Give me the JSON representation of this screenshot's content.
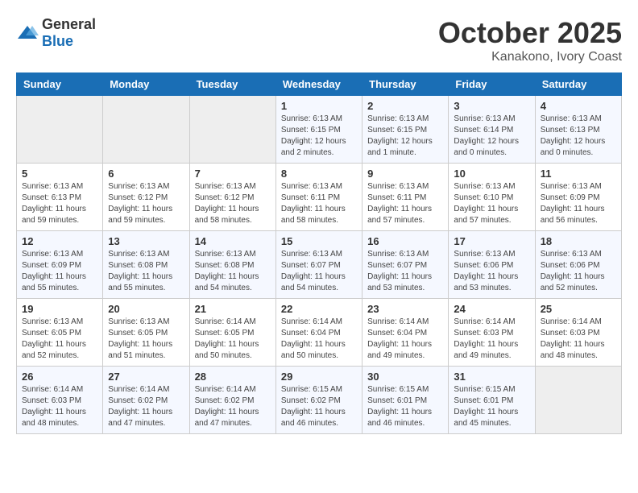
{
  "header": {
    "logo_general": "General",
    "logo_blue": "Blue",
    "month": "October 2025",
    "location": "Kanakono, Ivory Coast"
  },
  "weekdays": [
    "Sunday",
    "Monday",
    "Tuesday",
    "Wednesday",
    "Thursday",
    "Friday",
    "Saturday"
  ],
  "weeks": [
    {
      "days": [
        {
          "num": "",
          "info": "",
          "empty": true
        },
        {
          "num": "",
          "info": "",
          "empty": true
        },
        {
          "num": "",
          "info": "",
          "empty": true
        },
        {
          "num": "1",
          "info": "Sunrise: 6:13 AM\nSunset: 6:15 PM\nDaylight: 12 hours\nand 2 minutes."
        },
        {
          "num": "2",
          "info": "Sunrise: 6:13 AM\nSunset: 6:15 PM\nDaylight: 12 hours\nand 1 minute."
        },
        {
          "num": "3",
          "info": "Sunrise: 6:13 AM\nSunset: 6:14 PM\nDaylight: 12 hours\nand 0 minutes."
        },
        {
          "num": "4",
          "info": "Sunrise: 6:13 AM\nSunset: 6:13 PM\nDaylight: 12 hours\nand 0 minutes."
        }
      ]
    },
    {
      "days": [
        {
          "num": "5",
          "info": "Sunrise: 6:13 AM\nSunset: 6:13 PM\nDaylight: 11 hours\nand 59 minutes."
        },
        {
          "num": "6",
          "info": "Sunrise: 6:13 AM\nSunset: 6:12 PM\nDaylight: 11 hours\nand 59 minutes."
        },
        {
          "num": "7",
          "info": "Sunrise: 6:13 AM\nSunset: 6:12 PM\nDaylight: 11 hours\nand 58 minutes."
        },
        {
          "num": "8",
          "info": "Sunrise: 6:13 AM\nSunset: 6:11 PM\nDaylight: 11 hours\nand 58 minutes."
        },
        {
          "num": "9",
          "info": "Sunrise: 6:13 AM\nSunset: 6:11 PM\nDaylight: 11 hours\nand 57 minutes."
        },
        {
          "num": "10",
          "info": "Sunrise: 6:13 AM\nSunset: 6:10 PM\nDaylight: 11 hours\nand 57 minutes."
        },
        {
          "num": "11",
          "info": "Sunrise: 6:13 AM\nSunset: 6:09 PM\nDaylight: 11 hours\nand 56 minutes."
        }
      ]
    },
    {
      "days": [
        {
          "num": "12",
          "info": "Sunrise: 6:13 AM\nSunset: 6:09 PM\nDaylight: 11 hours\nand 55 minutes."
        },
        {
          "num": "13",
          "info": "Sunrise: 6:13 AM\nSunset: 6:08 PM\nDaylight: 11 hours\nand 55 minutes."
        },
        {
          "num": "14",
          "info": "Sunrise: 6:13 AM\nSunset: 6:08 PM\nDaylight: 11 hours\nand 54 minutes."
        },
        {
          "num": "15",
          "info": "Sunrise: 6:13 AM\nSunset: 6:07 PM\nDaylight: 11 hours\nand 54 minutes."
        },
        {
          "num": "16",
          "info": "Sunrise: 6:13 AM\nSunset: 6:07 PM\nDaylight: 11 hours\nand 53 minutes."
        },
        {
          "num": "17",
          "info": "Sunrise: 6:13 AM\nSunset: 6:06 PM\nDaylight: 11 hours\nand 53 minutes."
        },
        {
          "num": "18",
          "info": "Sunrise: 6:13 AM\nSunset: 6:06 PM\nDaylight: 11 hours\nand 52 minutes."
        }
      ]
    },
    {
      "days": [
        {
          "num": "19",
          "info": "Sunrise: 6:13 AM\nSunset: 6:05 PM\nDaylight: 11 hours\nand 52 minutes."
        },
        {
          "num": "20",
          "info": "Sunrise: 6:13 AM\nSunset: 6:05 PM\nDaylight: 11 hours\nand 51 minutes."
        },
        {
          "num": "21",
          "info": "Sunrise: 6:14 AM\nSunset: 6:05 PM\nDaylight: 11 hours\nand 50 minutes."
        },
        {
          "num": "22",
          "info": "Sunrise: 6:14 AM\nSunset: 6:04 PM\nDaylight: 11 hours\nand 50 minutes."
        },
        {
          "num": "23",
          "info": "Sunrise: 6:14 AM\nSunset: 6:04 PM\nDaylight: 11 hours\nand 49 minutes."
        },
        {
          "num": "24",
          "info": "Sunrise: 6:14 AM\nSunset: 6:03 PM\nDaylight: 11 hours\nand 49 minutes."
        },
        {
          "num": "25",
          "info": "Sunrise: 6:14 AM\nSunset: 6:03 PM\nDaylight: 11 hours\nand 48 minutes."
        }
      ]
    },
    {
      "days": [
        {
          "num": "26",
          "info": "Sunrise: 6:14 AM\nSunset: 6:03 PM\nDaylight: 11 hours\nand 48 minutes."
        },
        {
          "num": "27",
          "info": "Sunrise: 6:14 AM\nSunset: 6:02 PM\nDaylight: 11 hours\nand 47 minutes."
        },
        {
          "num": "28",
          "info": "Sunrise: 6:14 AM\nSunset: 6:02 PM\nDaylight: 11 hours\nand 47 minutes."
        },
        {
          "num": "29",
          "info": "Sunrise: 6:15 AM\nSunset: 6:02 PM\nDaylight: 11 hours\nand 46 minutes."
        },
        {
          "num": "30",
          "info": "Sunrise: 6:15 AM\nSunset: 6:01 PM\nDaylight: 11 hours\nand 46 minutes."
        },
        {
          "num": "31",
          "info": "Sunrise: 6:15 AM\nSunset: 6:01 PM\nDaylight: 11 hours\nand 45 minutes."
        },
        {
          "num": "",
          "info": "",
          "empty": true
        }
      ]
    }
  ]
}
